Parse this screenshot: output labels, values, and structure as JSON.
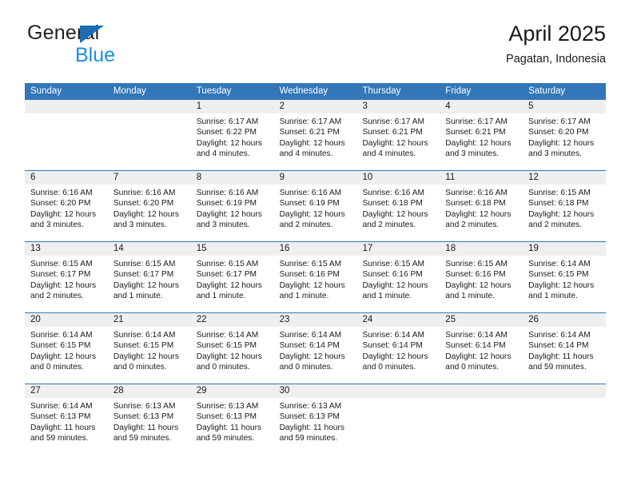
{
  "brand": {
    "name_part1": "General",
    "name_part2": "Blue",
    "accent_color": "#1b6cb3",
    "blue_text_color": "#1b8fe0",
    "logo_icon": "triangle-icon"
  },
  "header": {
    "title": "April 2025",
    "subtitle": "Pagatan, Indonesia"
  },
  "theme": {
    "header_blue": "#3277b8",
    "date_band_gray": "#efefef",
    "text_color": "#1a1a1a"
  },
  "weekdays": [
    "Sunday",
    "Monday",
    "Tuesday",
    "Wednesday",
    "Thursday",
    "Friday",
    "Saturday"
  ],
  "weeks": [
    [
      {
        "day": "",
        "sunrise": "",
        "sunset": "",
        "daylight_line1": "",
        "daylight_line2": ""
      },
      {
        "day": "",
        "sunrise": "",
        "sunset": "",
        "daylight_line1": "",
        "daylight_line2": ""
      },
      {
        "day": "1",
        "sunrise": "Sunrise: 6:17 AM",
        "sunset": "Sunset: 6:22 PM",
        "daylight_line1": "Daylight: 12 hours",
        "daylight_line2": "and 4 minutes."
      },
      {
        "day": "2",
        "sunrise": "Sunrise: 6:17 AM",
        "sunset": "Sunset: 6:21 PM",
        "daylight_line1": "Daylight: 12 hours",
        "daylight_line2": "and 4 minutes."
      },
      {
        "day": "3",
        "sunrise": "Sunrise: 6:17 AM",
        "sunset": "Sunset: 6:21 PM",
        "daylight_line1": "Daylight: 12 hours",
        "daylight_line2": "and 4 minutes."
      },
      {
        "day": "4",
        "sunrise": "Sunrise: 6:17 AM",
        "sunset": "Sunset: 6:21 PM",
        "daylight_line1": "Daylight: 12 hours",
        "daylight_line2": "and 3 minutes."
      },
      {
        "day": "5",
        "sunrise": "Sunrise: 6:17 AM",
        "sunset": "Sunset: 6:20 PM",
        "daylight_line1": "Daylight: 12 hours",
        "daylight_line2": "and 3 minutes."
      }
    ],
    [
      {
        "day": "6",
        "sunrise": "Sunrise: 6:16 AM",
        "sunset": "Sunset: 6:20 PM",
        "daylight_line1": "Daylight: 12 hours",
        "daylight_line2": "and 3 minutes."
      },
      {
        "day": "7",
        "sunrise": "Sunrise: 6:16 AM",
        "sunset": "Sunset: 6:20 PM",
        "daylight_line1": "Daylight: 12 hours",
        "daylight_line2": "and 3 minutes."
      },
      {
        "day": "8",
        "sunrise": "Sunrise: 6:16 AM",
        "sunset": "Sunset: 6:19 PM",
        "daylight_line1": "Daylight: 12 hours",
        "daylight_line2": "and 3 minutes."
      },
      {
        "day": "9",
        "sunrise": "Sunrise: 6:16 AM",
        "sunset": "Sunset: 6:19 PM",
        "daylight_line1": "Daylight: 12 hours",
        "daylight_line2": "and 2 minutes."
      },
      {
        "day": "10",
        "sunrise": "Sunrise: 6:16 AM",
        "sunset": "Sunset: 6:18 PM",
        "daylight_line1": "Daylight: 12 hours",
        "daylight_line2": "and 2 minutes."
      },
      {
        "day": "11",
        "sunrise": "Sunrise: 6:16 AM",
        "sunset": "Sunset: 6:18 PM",
        "daylight_line1": "Daylight: 12 hours",
        "daylight_line2": "and 2 minutes."
      },
      {
        "day": "12",
        "sunrise": "Sunrise: 6:15 AM",
        "sunset": "Sunset: 6:18 PM",
        "daylight_line1": "Daylight: 12 hours",
        "daylight_line2": "and 2 minutes."
      }
    ],
    [
      {
        "day": "13",
        "sunrise": "Sunrise: 6:15 AM",
        "sunset": "Sunset: 6:17 PM",
        "daylight_line1": "Daylight: 12 hours",
        "daylight_line2": "and 2 minutes."
      },
      {
        "day": "14",
        "sunrise": "Sunrise: 6:15 AM",
        "sunset": "Sunset: 6:17 PM",
        "daylight_line1": "Daylight: 12 hours",
        "daylight_line2": "and 1 minute."
      },
      {
        "day": "15",
        "sunrise": "Sunrise: 6:15 AM",
        "sunset": "Sunset: 6:17 PM",
        "daylight_line1": "Daylight: 12 hours",
        "daylight_line2": "and 1 minute."
      },
      {
        "day": "16",
        "sunrise": "Sunrise: 6:15 AM",
        "sunset": "Sunset: 6:16 PM",
        "daylight_line1": "Daylight: 12 hours",
        "daylight_line2": "and 1 minute."
      },
      {
        "day": "17",
        "sunrise": "Sunrise: 6:15 AM",
        "sunset": "Sunset: 6:16 PM",
        "daylight_line1": "Daylight: 12 hours",
        "daylight_line2": "and 1 minute."
      },
      {
        "day": "18",
        "sunrise": "Sunrise: 6:15 AM",
        "sunset": "Sunset: 6:16 PM",
        "daylight_line1": "Daylight: 12 hours",
        "daylight_line2": "and 1 minute."
      },
      {
        "day": "19",
        "sunrise": "Sunrise: 6:14 AM",
        "sunset": "Sunset: 6:15 PM",
        "daylight_line1": "Daylight: 12 hours",
        "daylight_line2": "and 1 minute."
      }
    ],
    [
      {
        "day": "20",
        "sunrise": "Sunrise: 6:14 AM",
        "sunset": "Sunset: 6:15 PM",
        "daylight_line1": "Daylight: 12 hours",
        "daylight_line2": "and 0 minutes."
      },
      {
        "day": "21",
        "sunrise": "Sunrise: 6:14 AM",
        "sunset": "Sunset: 6:15 PM",
        "daylight_line1": "Daylight: 12 hours",
        "daylight_line2": "and 0 minutes."
      },
      {
        "day": "22",
        "sunrise": "Sunrise: 6:14 AM",
        "sunset": "Sunset: 6:15 PM",
        "daylight_line1": "Daylight: 12 hours",
        "daylight_line2": "and 0 minutes."
      },
      {
        "day": "23",
        "sunrise": "Sunrise: 6:14 AM",
        "sunset": "Sunset: 6:14 PM",
        "daylight_line1": "Daylight: 12 hours",
        "daylight_line2": "and 0 minutes."
      },
      {
        "day": "24",
        "sunrise": "Sunrise: 6:14 AM",
        "sunset": "Sunset: 6:14 PM",
        "daylight_line1": "Daylight: 12 hours",
        "daylight_line2": "and 0 minutes."
      },
      {
        "day": "25",
        "sunrise": "Sunrise: 6:14 AM",
        "sunset": "Sunset: 6:14 PM",
        "daylight_line1": "Daylight: 12 hours",
        "daylight_line2": "and 0 minutes."
      },
      {
        "day": "26",
        "sunrise": "Sunrise: 6:14 AM",
        "sunset": "Sunset: 6:14 PM",
        "daylight_line1": "Daylight: 11 hours",
        "daylight_line2": "and 59 minutes."
      }
    ],
    [
      {
        "day": "27",
        "sunrise": "Sunrise: 6:14 AM",
        "sunset": "Sunset: 6:13 PM",
        "daylight_line1": "Daylight: 11 hours",
        "daylight_line2": "and 59 minutes."
      },
      {
        "day": "28",
        "sunrise": "Sunrise: 6:13 AM",
        "sunset": "Sunset: 6:13 PM",
        "daylight_line1": "Daylight: 11 hours",
        "daylight_line2": "and 59 minutes."
      },
      {
        "day": "29",
        "sunrise": "Sunrise: 6:13 AM",
        "sunset": "Sunset: 6:13 PM",
        "daylight_line1": "Daylight: 11 hours",
        "daylight_line2": "and 59 minutes."
      },
      {
        "day": "30",
        "sunrise": "Sunrise: 6:13 AM",
        "sunset": "Sunset: 6:13 PM",
        "daylight_line1": "Daylight: 11 hours",
        "daylight_line2": "and 59 minutes."
      },
      {
        "day": "",
        "sunrise": "",
        "sunset": "",
        "daylight_line1": "",
        "daylight_line2": ""
      },
      {
        "day": "",
        "sunrise": "",
        "sunset": "",
        "daylight_line1": "",
        "daylight_line2": ""
      },
      {
        "day": "",
        "sunrise": "",
        "sunset": "",
        "daylight_line1": "",
        "daylight_line2": ""
      }
    ]
  ]
}
